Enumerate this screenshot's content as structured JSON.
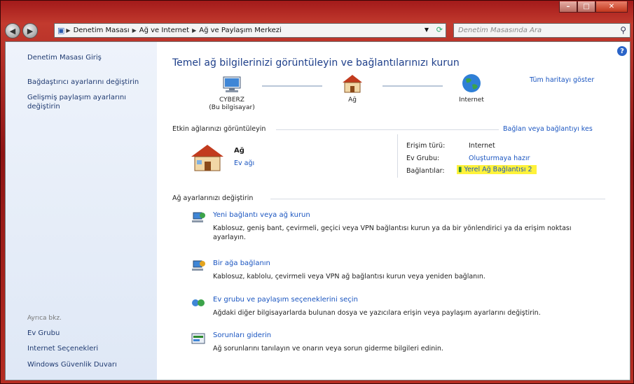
{
  "window": {
    "min_label": "–",
    "max_label": "□",
    "close_label": "✕"
  },
  "nav": {
    "back_icon": "back-arrow-icon",
    "forward_icon": "forward-arrow-icon",
    "breadcrumbs": [
      "Denetim Masası",
      "Ağ ve Internet",
      "Ağ ve Paylaşım Merkezi"
    ],
    "search_placeholder": "Denetim Masasında Ara"
  },
  "sidebar": {
    "top_links": [
      "Denetim Masası Giriş",
      "Bağdaştırıcı ayarlarını değiştirin",
      "Gelişmiş paylaşım ayarlarını değiştirin"
    ],
    "see_also_label": "Ayrıca bkz.",
    "bottom_links": [
      "Ev Grubu",
      "Internet Seçenekleri",
      "Windows Güvenlik Duvarı"
    ]
  },
  "main": {
    "title": "Temel ağ bilgilerinizi görüntüleyin ve bağlantılarınızı kurun",
    "full_map_link": "Tüm haritayı göster",
    "map": {
      "computer_name": "CYBERZ",
      "computer_sub": "(Bu bilgisayar)",
      "network": "Ağ",
      "internet": "Internet"
    },
    "active_networks_label": "Etkin ağlarınızı görüntüleyin",
    "connect_link": "Bağlan veya bağlantıyı kes",
    "network_name": "Ağ",
    "network_type": "Ev ağı",
    "access_type_label": "Erişim türü:",
    "access_type_value": "Internet",
    "homegroup_label": "Ev Grubu:",
    "homegroup_value": "Oluşturmaya hazır",
    "connections_label": "Bağlantılar:",
    "connections_value": "Yerel Ağ Bağlantısı 2",
    "change_settings_label": "Ağ ayarlarınızı değiştirin",
    "tasks": [
      {
        "title": "Yeni bağlantı veya ağ kurun",
        "desc": "Kablosuz, geniş bant, çevirmeli, geçici veya VPN bağlantısı kurun ya da bir yönlendirici ya da erişim noktası ayarlayın."
      },
      {
        "title": "Bir ağa bağlanın",
        "desc": "Kablosuz, kablolu, çevirmeli veya VPN ağ bağlantısı kurun veya yeniden bağlanın."
      },
      {
        "title": "Ev grubu ve paylaşım seçeneklerini seçin",
        "desc": "Ağdaki diğer bilgisayarlarda bulunan dosya ve yazıcılara erişin veya paylaşım ayarlarını değiştirin."
      },
      {
        "title": "Sorunları giderin",
        "desc": "Ağ sorunlarını tanılayın ve onarın veya sorun giderme bilgileri edinin."
      }
    ]
  },
  "colors": {
    "accent_link": "#1a55c0",
    "title_blue": "#1e3f8a",
    "highlight": "#fff23a",
    "frame": "#a31a1a"
  }
}
